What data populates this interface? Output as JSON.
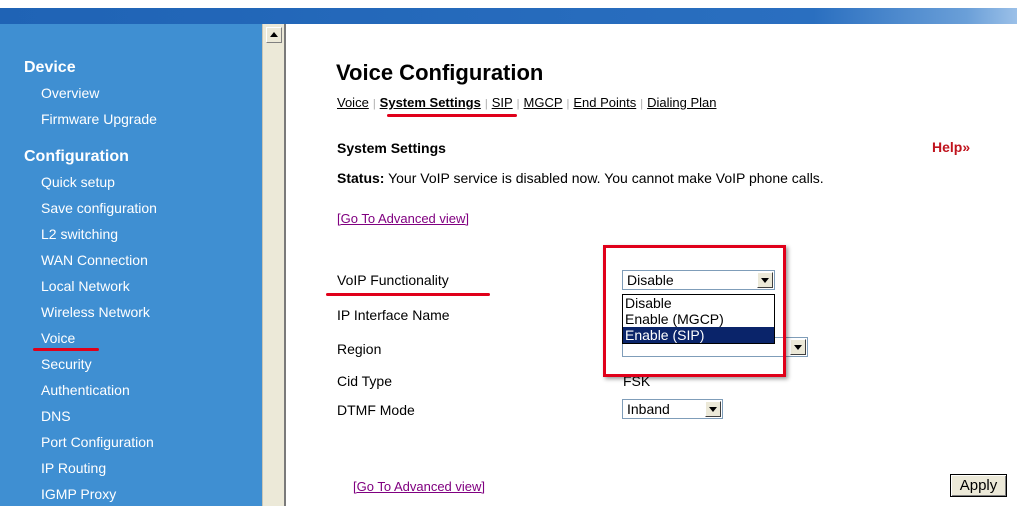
{
  "sidebar": {
    "sections": [
      {
        "title": "Device",
        "items": [
          "Overview",
          "Firmware Upgrade"
        ]
      },
      {
        "title": "Configuration",
        "items": [
          "Quick setup",
          "Save configuration",
          "L2 switching",
          "WAN Connection",
          "Local Network",
          "Wireless Network",
          "Voice",
          "Security",
          "Authentication",
          "DNS",
          "Port Configuration",
          "IP Routing",
          "IGMP Proxy"
        ]
      }
    ],
    "active_item": "Voice"
  },
  "main": {
    "title": "Voice Configuration",
    "tabs": [
      "Voice",
      "System Settings",
      "SIP",
      "MGCP",
      "End Points",
      "Dialing Plan"
    ],
    "active_tab": "System Settings",
    "section_title": "System Settings",
    "help_label": "Help",
    "help_icon": "double-chevron-right-icon",
    "status_label": "Status:",
    "status_text": " Your VoIP service is disabled now. You cannot make VoIP phone calls.",
    "advanced_link": "[Go To Advanced view]",
    "advanced_link_bottom": "[Go To Advanced view]",
    "apply_label": "Apply"
  },
  "form": {
    "voip_label": "VoIP Functionality",
    "voip_value": "Disable",
    "voip_options": [
      "Disable",
      "Enable (MGCP)",
      "Enable (SIP)"
    ],
    "voip_highlighted": "Enable (SIP)",
    "ip_interface_label": "IP Interface Name",
    "region_label": "Region",
    "cid_label": "Cid Type",
    "cid_value": "FSK",
    "dtmf_label": "DTMF Mode",
    "dtmf_value": "Inband"
  },
  "colors": {
    "sidebar_bg": "#3f8fd2",
    "annotation_red": "#e0001a",
    "help_red": "#c0141e",
    "link_visited": "#800080",
    "selection": "#0a246a"
  }
}
